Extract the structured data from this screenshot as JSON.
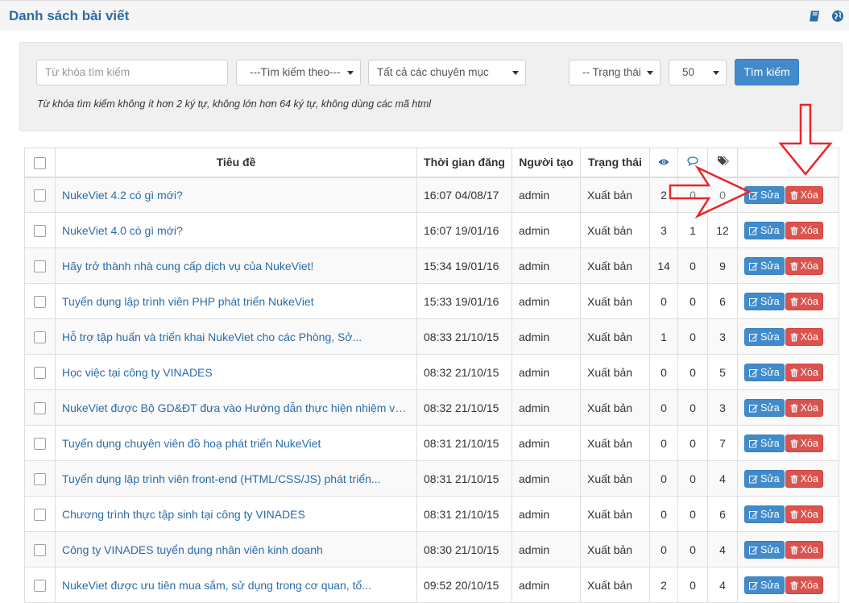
{
  "header": {
    "title": "Danh sách bài viết",
    "icons": [
      "book-icon",
      "globe-icon"
    ]
  },
  "filters": {
    "keyword_placeholder": "Từ khóa tìm kiếm",
    "search_by": "---Tìm kiếm theo---",
    "category": "Tất cả các chuyên mục",
    "status": "-- Trạng thái",
    "per_page": "50",
    "search_button": "Tìm kiếm",
    "hint": "Từ khóa tìm kiếm không ít hơn 2 ký tự, không lớn hơn 64 ký tự, không dùng các mã html"
  },
  "table": {
    "headers": {
      "title": "Tiêu đề",
      "publish_time": "Thời gian đăng",
      "author": "Người tạo",
      "status": "Trạng thái",
      "views_icon": "eye-icon",
      "comments_icon": "comment-icon",
      "tags_icon": "tags-icon"
    },
    "edit_label": "Sửa",
    "delete_label": "Xóa",
    "rows": [
      {
        "title": "NukeViet 4.2 có gì mới?",
        "time": "16:07 04/08/17",
        "author": "admin",
        "status": "Xuất bản",
        "views": "2",
        "comments": "0",
        "tags": "0"
      },
      {
        "title": "NukeViet 4.0 có gì mới?",
        "time": "16:07 19/01/16",
        "author": "admin",
        "status": "Xuất bản",
        "views": "3",
        "comments": "1",
        "tags": "12"
      },
      {
        "title": "Hãy trở thành nhà cung cấp dịch vụ của NukeViet!",
        "time": "15:34 19/01/16",
        "author": "admin",
        "status": "Xuất bản",
        "views": "14",
        "comments": "0",
        "tags": "9"
      },
      {
        "title": "Tuyển dụng lập trình viên PHP phát triển NukeViet",
        "time": "15:33 19/01/16",
        "author": "admin",
        "status": "Xuất bản",
        "views": "0",
        "comments": "0",
        "tags": "6"
      },
      {
        "title": "Hỗ trợ tập huấn và triển khai NukeViet cho các Phòng, Sở...",
        "time": "08:33 21/10/15",
        "author": "admin",
        "status": "Xuất bản",
        "views": "1",
        "comments": "0",
        "tags": "3"
      },
      {
        "title": "Học việc tại công ty VINADES",
        "time": "08:32 21/10/15",
        "author": "admin",
        "status": "Xuất bản",
        "views": "0",
        "comments": "0",
        "tags": "5"
      },
      {
        "title": "NukeViet được Bộ GD&ĐT đưa vào Hướng dẫn thực hiện nhiệm vụ...",
        "time": "08:32 21/10/15",
        "author": "admin",
        "status": "Xuất bản",
        "views": "0",
        "comments": "0",
        "tags": "3"
      },
      {
        "title": "Tuyển dụng chuyên viên đồ hoạ phát triển NukeViet",
        "time": "08:31 21/10/15",
        "author": "admin",
        "status": "Xuất bản",
        "views": "0",
        "comments": "0",
        "tags": "7"
      },
      {
        "title": "Tuyển dụng lập trình viên front-end (HTML/CSS/JS) phát triển...",
        "time": "08:31 21/10/15",
        "author": "admin",
        "status": "Xuất bản",
        "views": "0",
        "comments": "0",
        "tags": "4"
      },
      {
        "title": "Chương trình thực tập sinh tại công ty VINADES",
        "time": "08:31 21/10/15",
        "author": "admin",
        "status": "Xuất bản",
        "views": "0",
        "comments": "0",
        "tags": "6"
      },
      {
        "title": "Công ty VINADES tuyển dụng nhân viên kinh doanh",
        "time": "08:30 21/10/15",
        "author": "admin",
        "status": "Xuất bản",
        "views": "0",
        "comments": "0",
        "tags": "4"
      },
      {
        "title": "NukeViet được ưu tiên mua sắm, sử dụng trong cơ quan, tổ...",
        "time": "09:52 20/10/15",
        "author": "admin",
        "status": "Xuất bản",
        "views": "2",
        "comments": "0",
        "tags": "4"
      }
    ]
  },
  "annotations": {
    "arrow_color": "#e8262a"
  }
}
